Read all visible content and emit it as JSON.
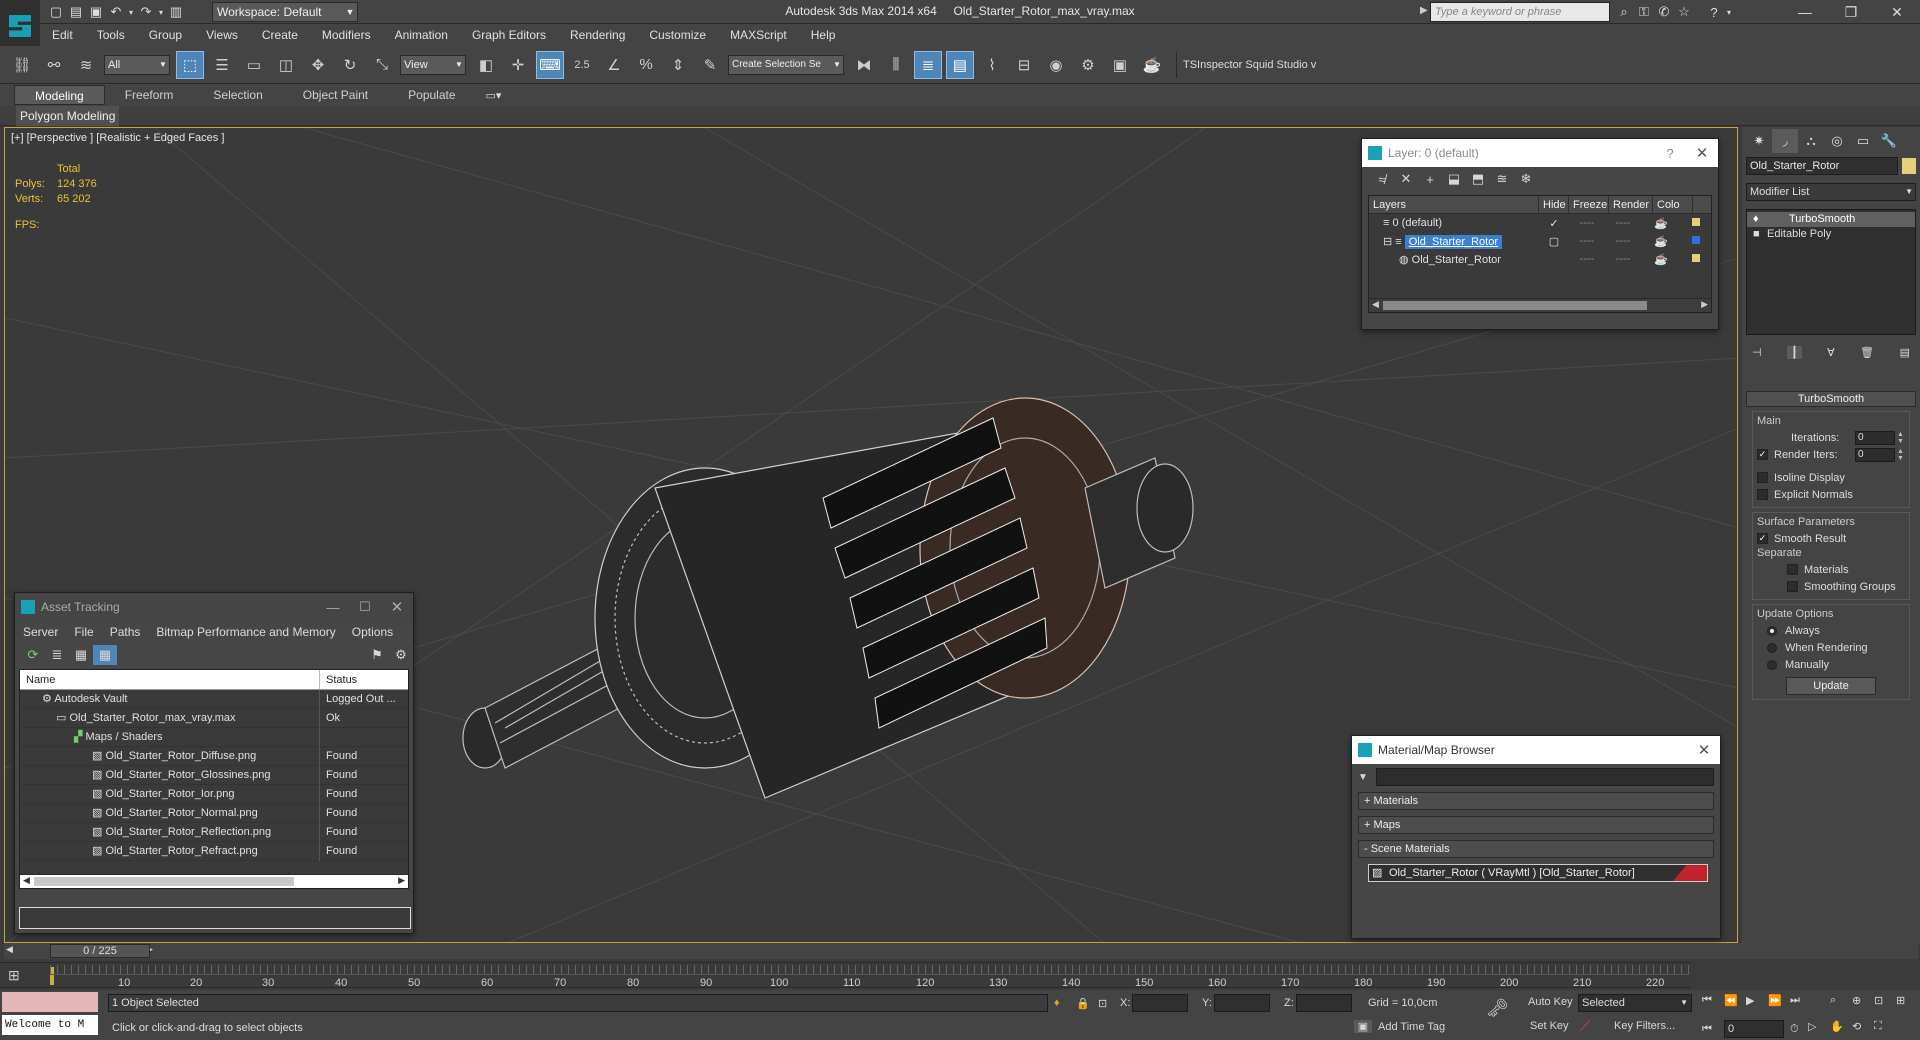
{
  "titlebar": {
    "workspace": "Workspace: Default",
    "app": "Autodesk 3ds Max  2014 x64",
    "file": "Old_Starter_Rotor_max_vray.max",
    "search_placeholder": "Type a keyword or phrase"
  },
  "menu": [
    "Edit",
    "Tools",
    "Group",
    "Views",
    "Create",
    "Modifiers",
    "Animation",
    "Graph Editors",
    "Rendering",
    "Customize",
    "MAXScript",
    "Help"
  ],
  "toolbar": {
    "selection_filter": "All",
    "ref_coord": "View",
    "snap_value": "2.5",
    "named_selection": "Create Selection Se",
    "plugin_text": "TSInspector  Squid Studio v"
  },
  "ribbon": {
    "tabs": [
      "Modeling",
      "Freeform",
      "Selection",
      "Object Paint",
      "Populate"
    ],
    "active": "Modeling",
    "subpanel": "Polygon Modeling"
  },
  "viewport": {
    "label": "[+] [Perspective ] [Realistic + Edged Faces ]",
    "stats_header": "Total",
    "polys_label": "Polys:",
    "polys": "124 376",
    "verts_label": "Verts:",
    "verts": "65 202",
    "fps_label": "FPS:"
  },
  "command_panel": {
    "object_name": "Old_Starter_Rotor",
    "modifier_list": "Modifier List",
    "stack": [
      "TurboSmooth",
      "Editable Poly"
    ],
    "rollout_title": "TurboSmooth",
    "main_label": "Main",
    "iterations_label": "Iterations:",
    "iterations": "0",
    "render_iters_label": "Render Iters:",
    "render_iters": "0",
    "isoline": "Isoline Display",
    "explicit_normals": "Explicit Normals",
    "surface_params": "Surface Parameters",
    "smooth_result": "Smooth Result",
    "separate": "Separate",
    "materials": "Materials",
    "smoothing_groups": "Smoothing Groups",
    "update_options": "Update Options",
    "always": "Always",
    "when_rendering": "When Rendering",
    "manually": "Manually",
    "update_button": "Update"
  },
  "layer_window": {
    "title": "Layer: 0 (default)",
    "help": "?",
    "columns": [
      "Layers",
      "Hide",
      "Freeze",
      "Render",
      "Colo"
    ],
    "rows": [
      {
        "name": "0 (default)",
        "color": "#e8d07a"
      },
      {
        "name": "Old_Starter_Rotor",
        "color": "#2f6fd6"
      },
      {
        "name": "Old_Starter_Rotor",
        "color": "#e8d07a"
      }
    ],
    "dash": "----"
  },
  "asset_window": {
    "title": "Asset Tracking",
    "menu": [
      "Server",
      "File",
      "Paths",
      "Bitmap Performance and Memory",
      "Options"
    ],
    "col_name": "Name",
    "col_status": "Status",
    "rows": [
      {
        "name": "Autodesk Vault",
        "status": "Logged Out ..."
      },
      {
        "name": "Old_Starter_Rotor_max_vray.max",
        "status": "Ok"
      },
      {
        "name": "Maps / Shaders",
        "status": ""
      },
      {
        "name": "Old_Starter_Rotor_Diffuse.png",
        "status": "Found"
      },
      {
        "name": "Old_Starter_Rotor_Glossines.png",
        "status": "Found"
      },
      {
        "name": "Old_Starter_Rotor_Ior.png",
        "status": "Found"
      },
      {
        "name": "Old_Starter_Rotor_Normal.png",
        "status": "Found"
      },
      {
        "name": "Old_Starter_Rotor_Reflection.png",
        "status": "Found"
      },
      {
        "name": "Old_Starter_Rotor_Refract.png",
        "status": "Found"
      }
    ]
  },
  "material_browser": {
    "title": "Material/Map Browser",
    "groups": [
      "+ Materials",
      "+ Maps",
      "- Scene Materials"
    ],
    "item": "Old_Starter_Rotor  ( VRayMtl )  [Old_Starter_Rotor]"
  },
  "timeline": {
    "frame": "0 / 225",
    "ticks": [
      "10",
      "20",
      "30",
      "40",
      "50",
      "60",
      "70",
      "80",
      "90",
      "100",
      "110",
      "120",
      "130",
      "140",
      "150",
      "160",
      "170",
      "180",
      "190",
      "200",
      "210",
      "220"
    ]
  },
  "status": {
    "maxscript_line": "Welcome to M",
    "selected": "1 Object Selected",
    "prompt": "Click or click-and-drag to select objects",
    "x_label": "X:",
    "y_label": "Y:",
    "z_label": "Z:",
    "grid": "Grid = 10,0cm",
    "add_time_tag": "Add Time Tag",
    "auto_key": "Auto Key",
    "set_key": "Set Key",
    "key_mode": "Selected",
    "key_filters": "Key Filters...",
    "current_frame": "0"
  }
}
